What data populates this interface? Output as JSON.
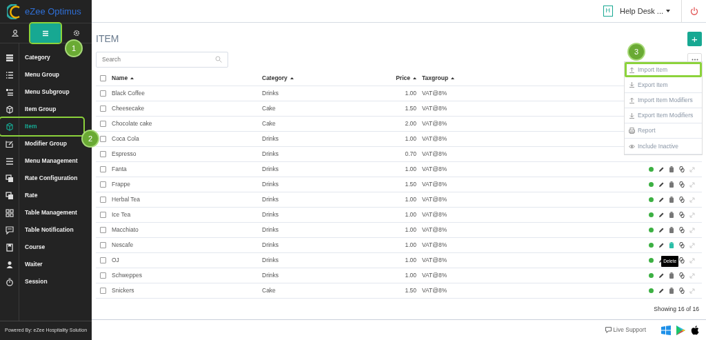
{
  "brand": {
    "name": "eZee Optimus"
  },
  "sidebar": {
    "tabs": [
      {
        "selected": false,
        "highlighted": false
      },
      {
        "selected": true,
        "highlighted": true
      },
      {
        "selected": false,
        "highlighted": false
      }
    ],
    "items": [
      {
        "label": "Category",
        "selected": false,
        "highlighted": false
      },
      {
        "label": "Menu Group",
        "selected": false,
        "highlighted": false
      },
      {
        "label": "Menu Subgroup",
        "selected": false,
        "highlighted": false
      },
      {
        "label": "Item Group",
        "selected": false,
        "highlighted": false
      },
      {
        "label": "Item",
        "selected": true,
        "highlighted": true
      },
      {
        "label": "Modifier Group",
        "selected": false,
        "highlighted": false
      },
      {
        "label": "Menu Management",
        "selected": false,
        "highlighted": false
      },
      {
        "label": "Rate Configuration",
        "selected": false,
        "highlighted": false
      },
      {
        "label": "Rate",
        "selected": false,
        "highlighted": false
      },
      {
        "label": "Table Management",
        "selected": false,
        "highlighted": false
      },
      {
        "label": "Table Notification",
        "selected": false,
        "highlighted": false
      },
      {
        "label": "Course",
        "selected": false,
        "highlighted": false
      },
      {
        "label": "Waiter",
        "selected": false,
        "highlighted": false
      },
      {
        "label": "Session",
        "selected": false,
        "highlighted": false
      }
    ],
    "footer": "Powered By: eZee Hospitality Solution"
  },
  "header": {
    "badge": "H",
    "user": "Help Desk ..."
  },
  "page": {
    "title": "ITEM",
    "add_button": "+",
    "search": {
      "placeholder": "Search"
    }
  },
  "table": {
    "all_checked": false,
    "columns": [
      "Name",
      "Category",
      "Price",
      "Taxgroup"
    ],
    "rows": [
      {
        "name": "Black Coffee",
        "category": "Drinks",
        "price": "1.00",
        "taxgroup": "VAT@8%",
        "checked": false
      },
      {
        "name": "Cheesecake",
        "category": "Cake",
        "price": "1.50",
        "taxgroup": "VAT@8%",
        "checked": false
      },
      {
        "name": "Chocolate cake",
        "category": "Cake",
        "price": "2.00",
        "taxgroup": "VAT@8%",
        "checked": false
      },
      {
        "name": "Coca Cola",
        "category": "Drinks",
        "price": "1.00",
        "taxgroup": "VAT@8%",
        "checked": false
      },
      {
        "name": "Espresso",
        "category": "Drinks",
        "price": "0.70",
        "taxgroup": "VAT@8%",
        "checked": false
      },
      {
        "name": "Fanta",
        "category": "Drinks",
        "price": "1.00",
        "taxgroup": "VAT@8%",
        "checked": false,
        "actions": {
          "active": true,
          "delete_hover": false
        }
      },
      {
        "name": "Frappe",
        "category": "Drinks",
        "price": "1.50",
        "taxgroup": "VAT@8%",
        "checked": false,
        "actions": {
          "active": true,
          "delete_hover": false
        }
      },
      {
        "name": "Herbal Tea",
        "category": "Drinks",
        "price": "1.00",
        "taxgroup": "VAT@8%",
        "checked": false,
        "actions": {
          "active": true,
          "delete_hover": false
        }
      },
      {
        "name": "Ice Tea",
        "category": "Drinks",
        "price": "1.00",
        "taxgroup": "VAT@8%",
        "checked": false,
        "actions": {
          "active": true,
          "delete_hover": false
        }
      },
      {
        "name": "Macchiato",
        "category": "Drinks",
        "price": "1.00",
        "taxgroup": "VAT@8%",
        "checked": false,
        "actions": {
          "active": true,
          "delete_hover": false
        }
      },
      {
        "name": "Nescafe",
        "category": "Drinks",
        "price": "1.00",
        "taxgroup": "VAT@8%",
        "checked": false,
        "actions": {
          "active": true,
          "delete_hover": true
        }
      },
      {
        "name": "OJ",
        "category": "Drinks",
        "price": "1.00",
        "taxgroup": "VAT@8%",
        "checked": false,
        "actions": {
          "active": true,
          "tooltip": "Delete"
        }
      },
      {
        "name": "Schweppes",
        "category": "Drinks",
        "price": "1.00",
        "taxgroup": "VAT@8%",
        "checked": false,
        "actions": {
          "active": true,
          "delete_hover": false
        }
      },
      {
        "name": "Snickers",
        "category": "Cake",
        "price": "1.50",
        "taxgroup": "VAT@8%",
        "checked": false,
        "actions": {
          "active": true,
          "delete_hover": false
        }
      }
    ],
    "summary": "Showing 16 of 16"
  },
  "menu": {
    "items": [
      {
        "label": "Import Item",
        "kind": "import",
        "highlighted": true
      },
      {
        "label": "Export Item",
        "kind": "export",
        "highlighted": false
      },
      {
        "label": "Import Item Modifiers",
        "kind": "import",
        "highlighted": false
      },
      {
        "label": "Export Item Modifiers",
        "kind": "export",
        "highlighted": false
      },
      {
        "label": "Report",
        "kind": "print",
        "highlighted": false
      },
      {
        "label": "Include Inactive",
        "kind": "view",
        "highlighted": false
      }
    ]
  },
  "callouts": [
    {
      "number": "1"
    },
    {
      "number": "2"
    },
    {
      "number": "3"
    }
  ],
  "footer": {
    "support": "Live Support"
  }
}
